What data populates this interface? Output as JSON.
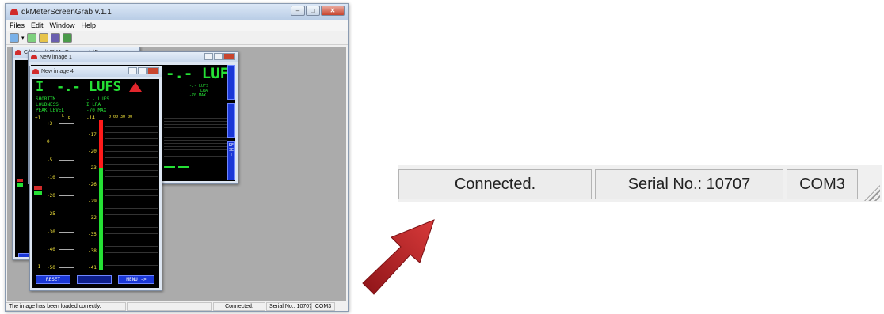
{
  "app": {
    "title": "dkMeterScreenGrab v.1.1",
    "menu": [
      "Files",
      "Edit",
      "Window",
      "Help"
    ]
  },
  "child_back": {
    "title": "C:\\Users\\US\\My Documents\\Ba..."
  },
  "child_mid": {
    "title": "New image 1",
    "lufs": "-.- LUFS",
    "side_labels": [
      "-.- LUFS",
      "LRA",
      "-70 MAX"
    ],
    "reset_vertical": "RESET"
  },
  "child_front": {
    "title": "New image 4",
    "big_left": "I",
    "big_reading": "-.- LUFS",
    "info_rows": [
      {
        "label": "SHORTTM",
        "value": "-.- LUFS"
      },
      {
        "label": "LOUDNESS",
        "value": "I   LRA"
      },
      {
        "label": "PEAK LEVEL",
        "value": "-70 MAX"
      }
    ],
    "top_labels": {
      "plus1": "+1",
      "l": "L",
      "r": "R",
      "minus14": "-14",
      "time": "0:00   30   00"
    },
    "left_scale": [
      "+3",
      "0",
      "-5",
      "-10",
      "-20",
      "-25",
      "-30",
      "-40",
      "-50"
    ],
    "right_scale": [
      "-17",
      "-20",
      "-23",
      "-26",
      "-29",
      "-32",
      "-35",
      "-38",
      "-41"
    ],
    "bottom_minus1": "-1",
    "buttons": {
      "reset": "RESET",
      "menu": "MENU ->"
    }
  },
  "statusbar": {
    "message": "The image has been loaded correctly.",
    "connection": "Connected.",
    "serial": "Serial No.: 10707",
    "port": "COM3"
  },
  "zoomed_statusbar": {
    "connection": "Connected.",
    "serial": "Serial No.: 10707",
    "port": "COM3"
  },
  "colors": {
    "meter_green": "#25e035",
    "meter_red": "#ff1a1a",
    "meter_yellow": "#f1e23a",
    "button_blue": "#1a37d6",
    "arrow_red": "#c0262c"
  }
}
